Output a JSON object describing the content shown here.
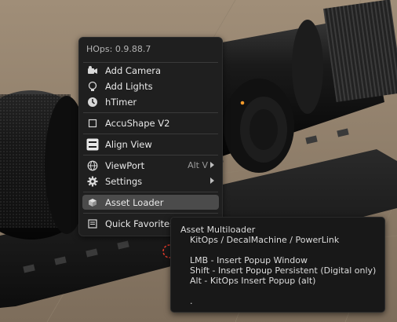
{
  "menu": {
    "title": "HOps: 0.9.88.7",
    "items": [
      {
        "label": "Add Camera",
        "icon": "camera-icon"
      },
      {
        "label": "Add Lights",
        "icon": "light-bulb-icon"
      },
      {
        "label": "hTimer",
        "icon": "clock-icon"
      },
      {
        "label": "AccuShape V2",
        "icon": "square-outline-icon"
      },
      {
        "label": "Align View",
        "icon": "align-view-icon"
      },
      {
        "label": "ViewPort",
        "icon": "globe-icon",
        "hint": "Alt V",
        "submenu": true
      },
      {
        "label": "Settings",
        "icon": "gear-icon",
        "submenu": true
      },
      {
        "label": "Asset Loader",
        "icon": "cube-icon",
        "active": true
      },
      {
        "label": "Quick Favorites",
        "icon": "favorites-list-icon"
      }
    ]
  },
  "tooltip": {
    "title": "Asset Multiloader",
    "lines": [
      "KitOps / DecalMachine / PowerLink",
      "",
      "LMB - Insert Popup Window",
      "Shift - Insert Popup Persistent (Digital only)",
      "Alt - KitOps Insert Popup (alt)",
      "",
      "."
    ]
  },
  "colors": {
    "menu_bg": "#1f1f1f",
    "highlight": "#4b4b4b",
    "tooltip_bg": "#181818",
    "accent_dot": "#f39a2b"
  }
}
